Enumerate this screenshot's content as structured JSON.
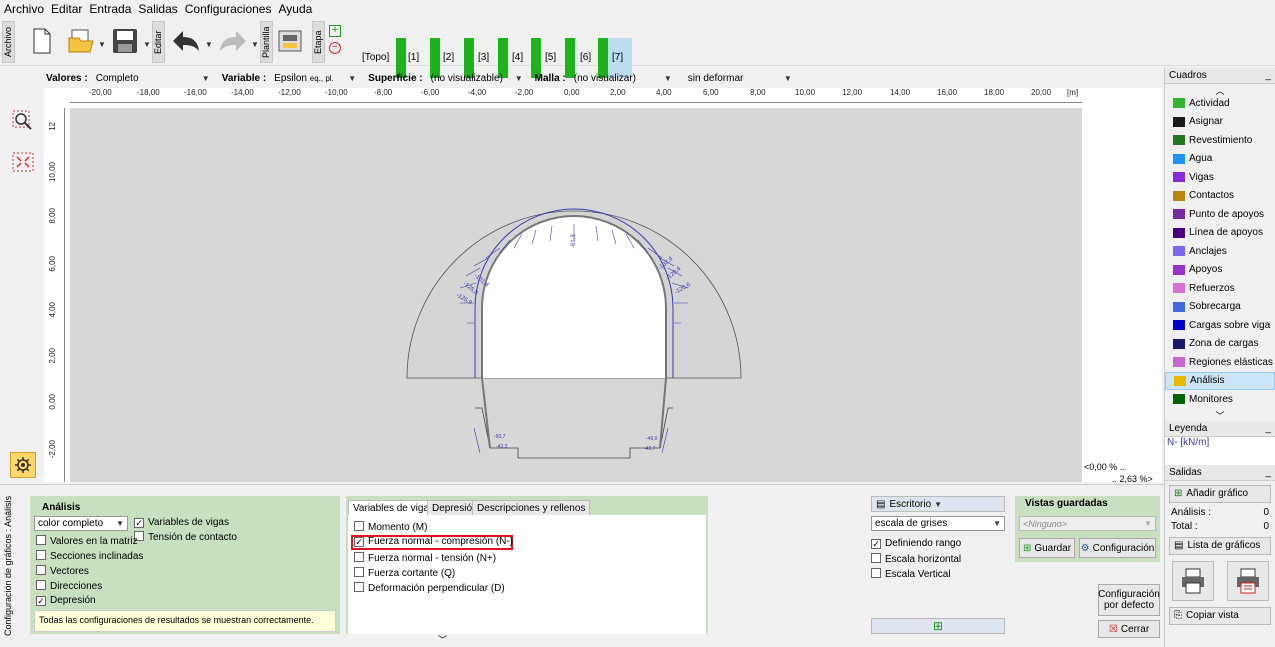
{
  "menu": [
    "Archivo",
    "Editar",
    "Entrada",
    "Salidas",
    "Configuraciones",
    "Ayuda"
  ],
  "toolbar": {
    "archivo_label": "Archivo",
    "editar_label": "Editar",
    "plantilla_label": "Plantilla",
    "etapa_label": "Etapa",
    "stages": [
      "[Topo]",
      "[1]",
      "[2]",
      "[3]",
      "[4]",
      "[5]",
      "[6]",
      "[7]"
    ]
  },
  "options": {
    "valores_label": "Valores :",
    "valores_value": "Completo",
    "variable_label": "Variable :",
    "variable_value": "Epsilon",
    "variable_sub": "eq., pl.",
    "superficie_label": "Superficie :",
    "superficie_value": "(no visualizable)",
    "malla_label": "Malla :",
    "malla_value": "(no visualizar)",
    "deform_value": "sin deformar"
  },
  "ruler": {
    "x_ticks": [
      "-20,00",
      "-18,00",
      "-16,00",
      "-14,00",
      "-12,00",
      "-10,00",
      "-8,00",
      "-6,00",
      "-4,00",
      "-2,00",
      "0,00",
      "2,00",
      "4,00",
      "6,00",
      "8,00",
      "10,00",
      "12,00",
      "14,00",
      "16,00",
      "18,00",
      "20,00",
      "[m]"
    ],
    "y_ticks": [
      "12",
      "10,00",
      "8,00",
      "6,00",
      "4,00",
      "2,00",
      "0,00",
      "-2,00"
    ]
  },
  "canvas": {
    "labels": [
      "-61,3",
      "-131,4",
      "-125,0",
      "-126,9",
      "-132,4",
      "-120,4",
      "-120,6",
      "-50,7",
      "-43,3",
      "-46,0",
      "-42,7"
    ],
    "scale_min": "<0,00 % ..",
    "scale_max": ".. 2,63 %>"
  },
  "cuadros": {
    "title": "Cuadros",
    "items": [
      "Actividad",
      "Asignar",
      "Revestimiento",
      "Agua",
      "Vigas",
      "Contactos",
      "Punto de apoyos",
      "Línea de apoyos",
      "Anclajes",
      "Apoyos",
      "Refuerzos",
      "Sobrecarga",
      "Cargas sobre viga",
      "Zona de cargas",
      "Regiones elásticas",
      "Análisis",
      "Monitores"
    ],
    "colors": [
      "#2fb52f",
      "#1a1a1a",
      "#1e7b1e",
      "#1e90ff",
      "#8a2be2",
      "#b8860b",
      "#7b2ba0",
      "#4b0082",
      "#7b68ee",
      "#9932cc",
      "#da70d6",
      "#4169e1",
      "#0000cd",
      "#191970",
      "#cc66cc",
      "#e6b800",
      "#006400"
    ]
  },
  "leyenda": {
    "title": "Leyenda",
    "value": "N- [kN/m]"
  },
  "salidas": {
    "title": "Salidas",
    "add_chart": "Añadir gráfico",
    "analisis_label": "Análisis :",
    "analisis_count": "0",
    "total_label": "Total :",
    "total_count": "0",
    "lista": "Lista de gráficos",
    "copiar": "Copiar vista"
  },
  "bottom": {
    "side_label": "Configuración de gráficos : Análisis",
    "analisis_title": "Análisis",
    "color_value": "color completo",
    "chk_variables_vigas": "Variables de vigas",
    "chk_tension_contacto": "Tensión de contacto",
    "chk_valores_matriz": "Valores en la matriz",
    "chk_secciones": "Secciones inclinadas",
    "chk_vectores": "Vectores",
    "chk_direcciones": "Direcciones",
    "chk_depresion": "Depresión",
    "info": "Todas las configuraciones de resultados se muestran correctamente.",
    "tabs": [
      "Variables de vigas",
      "Depresión",
      "Descripciones y rellenos"
    ],
    "beam_vars": [
      "Momento (M)",
      "Fuerza normal - compresión (N-)",
      "Fuerza normal - tensión (N+)",
      "Fuerza cortante (Q)",
      "Deformación perpendicular (D)"
    ],
    "escritorio": "Escritorio",
    "escala_value": "escala de grises",
    "chk_definiendo": "Definiendo rango",
    "chk_esc_h": "Escala horizontal",
    "chk_esc_v": "Escala Vertical",
    "vistas_title": "Vistas guardadas",
    "ninguno": "<Ninguno>",
    "guardar": "Guardar",
    "configuracion": "Configuración",
    "config_defecto_1": "Configuración",
    "config_defecto_2": "por defecto",
    "cerrar": "Cerrar"
  }
}
